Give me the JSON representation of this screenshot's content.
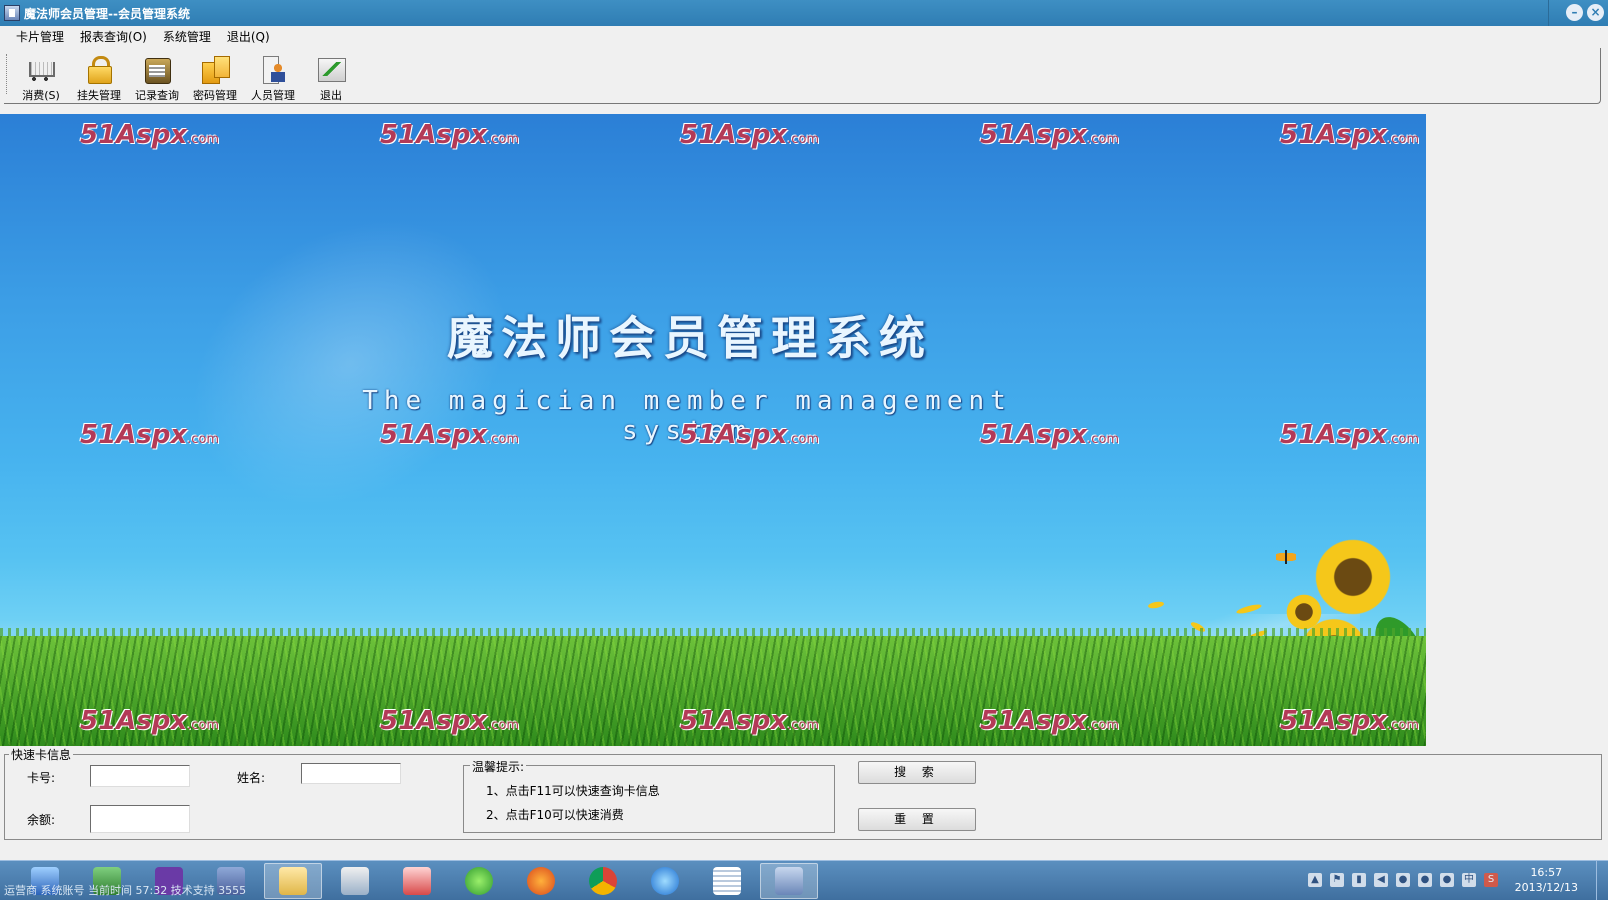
{
  "window": {
    "title": "魔法师会员管理--会员管理系统"
  },
  "menu": [
    {
      "label": "卡片管理"
    },
    {
      "label": "报表查询(O)"
    },
    {
      "label": "系统管理"
    },
    {
      "label": "退出(Q)"
    }
  ],
  "toolbar": [
    {
      "label": "消费(S)",
      "icon": "cart-icon"
    },
    {
      "label": "挂失管理",
      "icon": "lock-icon"
    },
    {
      "label": "记录查询",
      "icon": "record-icon"
    },
    {
      "label": "密码管理",
      "icon": "password-icon"
    },
    {
      "label": "人员管理",
      "icon": "user-icon"
    },
    {
      "label": "退出",
      "icon": "exit-icon"
    }
  ],
  "banner": {
    "title_cn": "魔法师会员管理系统",
    "title_en": "The magician member management system",
    "watermark_text": "51Aspx",
    "watermark_suffix": ".com"
  },
  "quick_card": {
    "legend": "快速卡信息",
    "card_no_label": "卡号:",
    "card_no_value": "",
    "name_label": "姓名:",
    "name_value": "",
    "balance_label": "余额:",
    "balance_value": "",
    "tips_legend": "温馨提示:",
    "tips": [
      "1、点击F11可以快速查询卡信息",
      "2、点击F10可以快速消费"
    ],
    "search_button": "搜 索",
    "reset_button": "重 置"
  },
  "statusbar": {
    "text": "运营商  系统账号  当前时间  57:32  技术支持  3555"
  },
  "taskbar": {
    "clock_time": "16:57",
    "clock_date": "2013/12/13",
    "ime_label": "中"
  },
  "colors": {
    "titlebar": "#2f7db3",
    "banner_sky": "#3c9ee6",
    "watermark": "#b33a57",
    "grass": "#2f8b1c"
  }
}
